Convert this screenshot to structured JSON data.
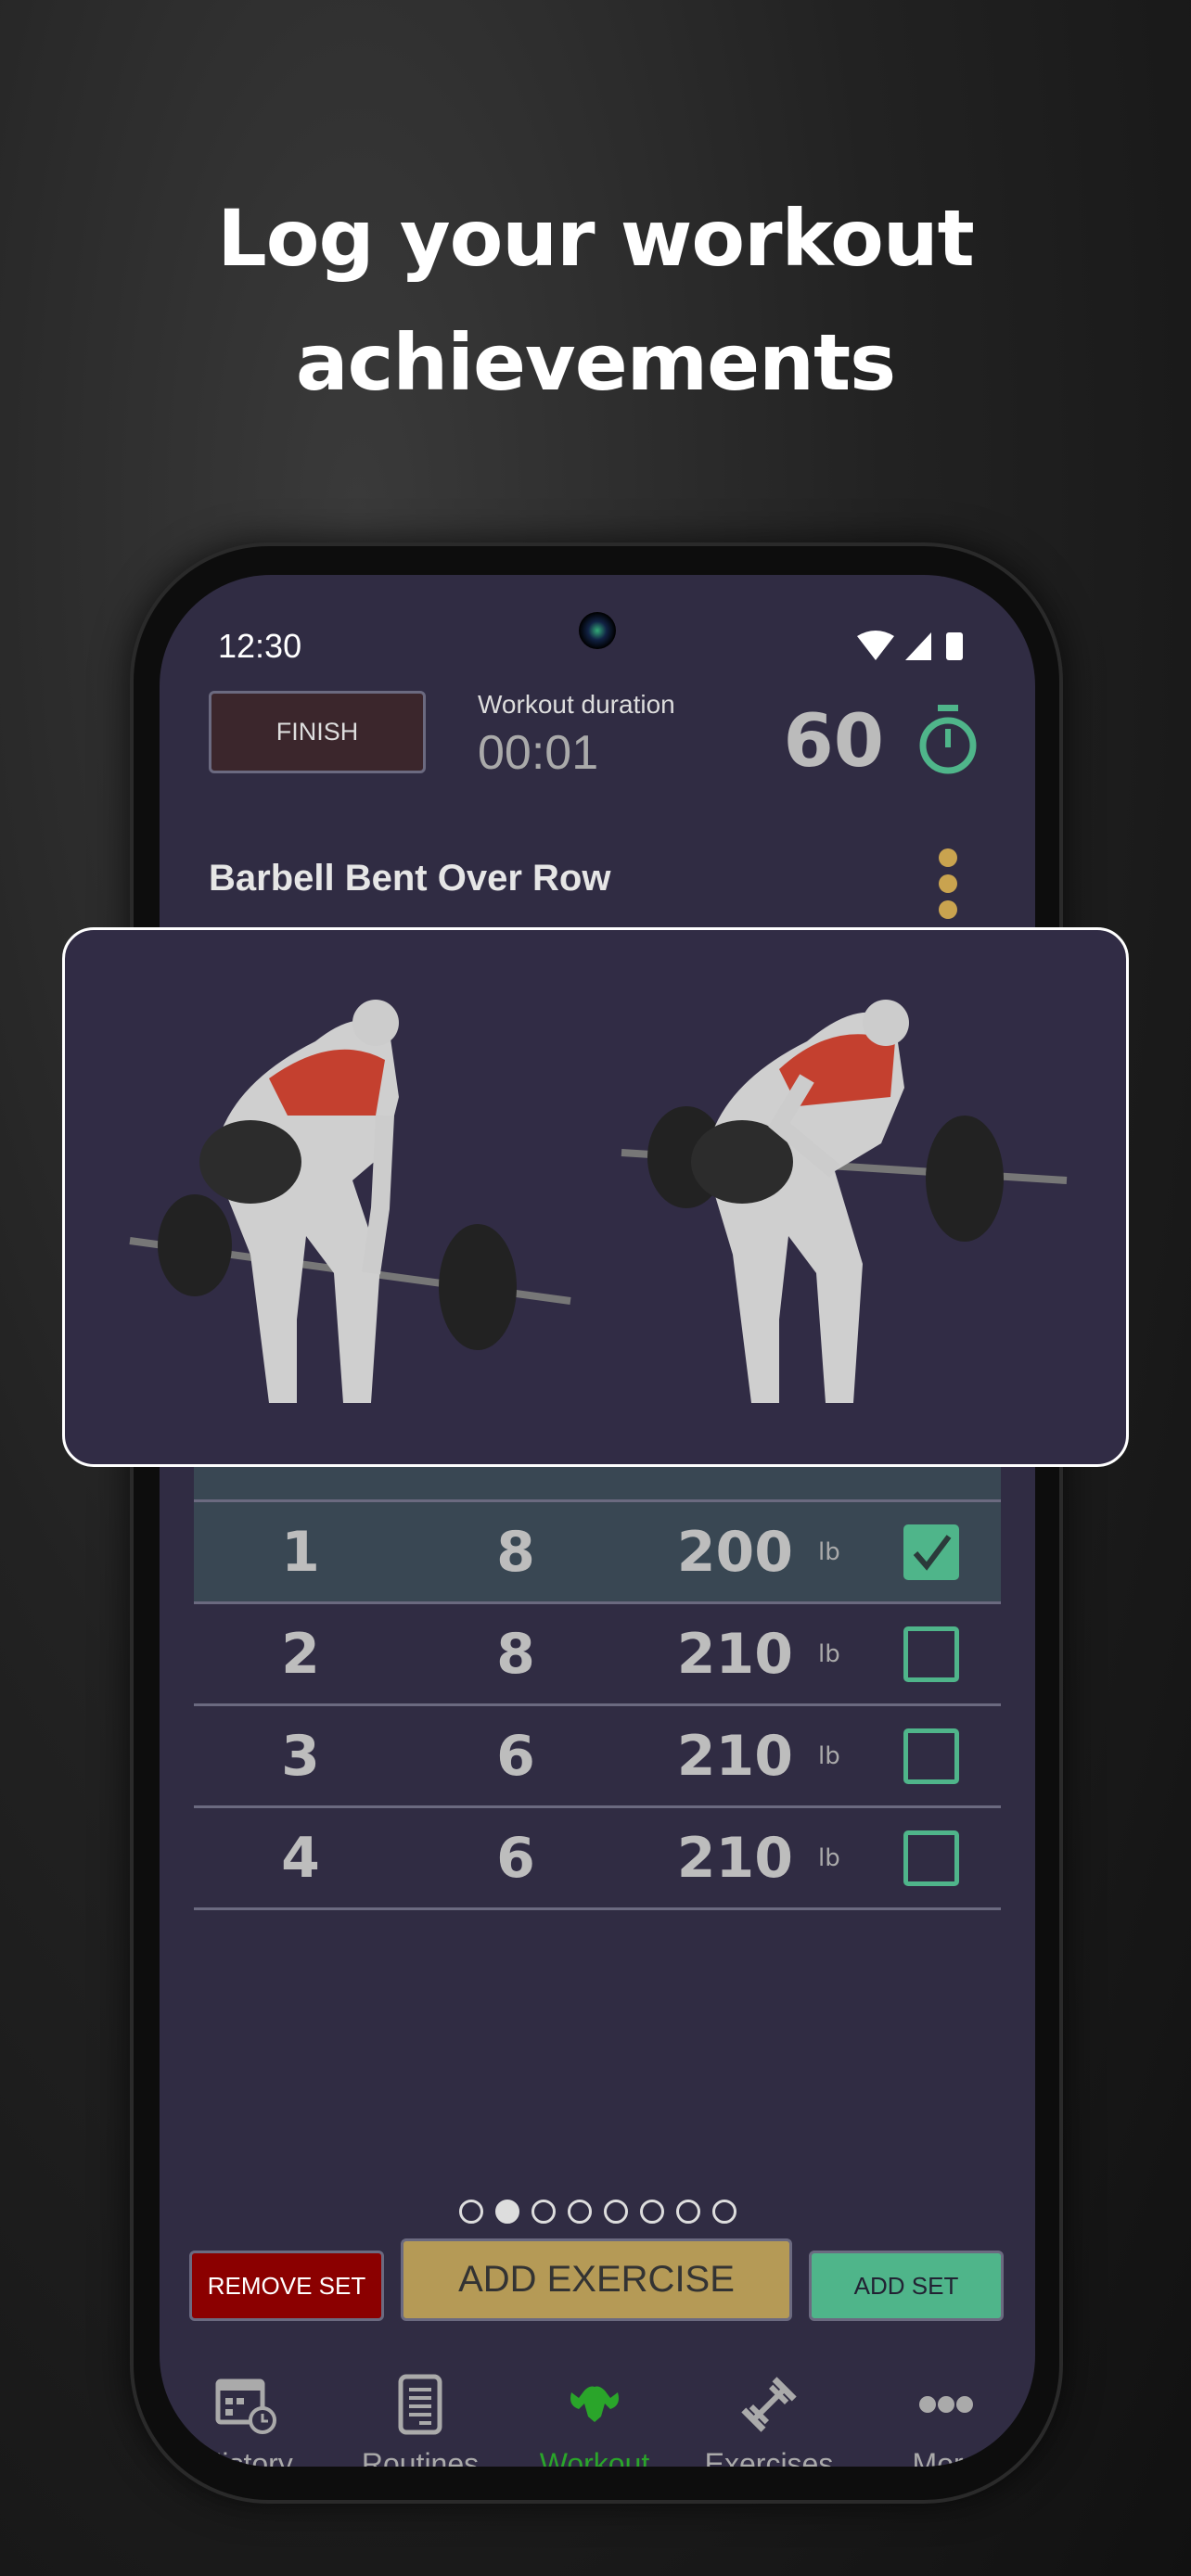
{
  "headline": {
    "line1": "Log your workout",
    "line2": "achievements"
  },
  "status_bar": {
    "time": "12:30"
  },
  "header": {
    "finish_label": "FINISH",
    "duration_label": "Workout duration",
    "duration_value": "00:01",
    "rest_timer": "60"
  },
  "exercise": {
    "title": "Barbell Bent Over Row"
  },
  "sets": [
    {
      "set": "1",
      "reps": "8",
      "weight": "200",
      "unit": "lb",
      "done": true
    },
    {
      "set": "2",
      "reps": "8",
      "weight": "210",
      "unit": "lb",
      "done": false
    },
    {
      "set": "3",
      "reps": "6",
      "weight": "210",
      "unit": "lb",
      "done": false
    },
    {
      "set": "4",
      "reps": "6",
      "weight": "210",
      "unit": "lb",
      "done": false
    }
  ],
  "pager": {
    "count": 8,
    "active": 2
  },
  "actions": {
    "remove_set": "REMOVE SET",
    "add_exercise": "ADD EXERCISE",
    "add_set": "ADD SET"
  },
  "nav": [
    {
      "label": "History",
      "icon": "calendar-clock-icon"
    },
    {
      "label": "Routines",
      "icon": "clipboard-list-icon"
    },
    {
      "label": "Workout",
      "icon": "muscle-icon",
      "active": true
    },
    {
      "label": "Exercises",
      "icon": "dumbbell-icon"
    },
    {
      "label": "More",
      "icon": "more-dots-icon"
    }
  ],
  "colors": {
    "accent_green": "#4fb58a",
    "active_nav": "#2aa52a",
    "remove": "#8b0000",
    "add_exercise": "#b59a56",
    "background": "#302c43"
  }
}
